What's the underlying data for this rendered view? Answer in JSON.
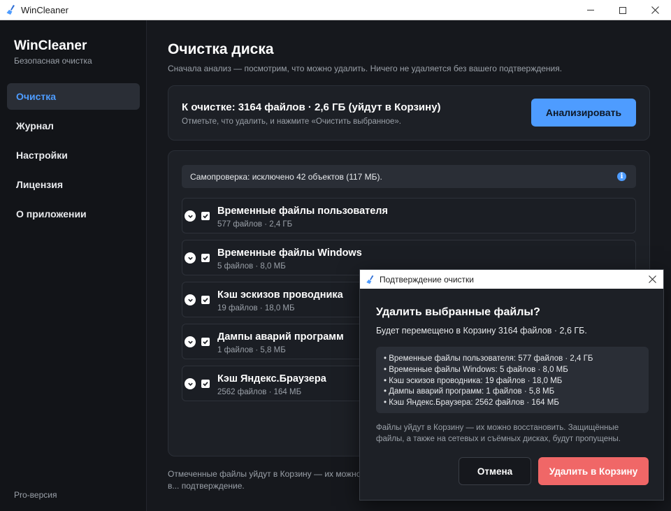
{
  "window": {
    "title": "WinCleaner",
    "icon": "broom-icon"
  },
  "sidebar": {
    "brand_name": "WinCleaner",
    "brand_sub": "Безопасная очистка",
    "items": [
      {
        "label": "Очистка",
        "active": true
      },
      {
        "label": "Журнал",
        "active": false
      },
      {
        "label": "Настройки",
        "active": false
      },
      {
        "label": "Лицензия",
        "active": false
      },
      {
        "label": "О приложении",
        "active": false
      }
    ],
    "pro_label": "Pro-версия"
  },
  "main": {
    "title": "Очистка диска",
    "subtitle": "Сначала анализ — посмотрим, что можно удалить. Ничего не удаляется без вашего подтверждения.",
    "summary": {
      "title": "К очистке: 3164 файлов · 2,6 ГБ (уйдут в Корзину)",
      "hint": "Отметьте, что удалить, и нажмите «Очистить выбранное».",
      "analyze_label": "Анализировать"
    },
    "selfcheck": "Самопроверка: исключено 42 объектов (117 МБ).",
    "categories": [
      {
        "name": "Временные файлы пользователя",
        "meta": "577 файлов · 2,4 ГБ",
        "checked": true
      },
      {
        "name": "Временные файлы Windows",
        "meta": "5 файлов · 8,0 МБ",
        "checked": true
      },
      {
        "name": "Кэш эскизов проводника",
        "meta": "19 файлов · 18,0 МБ",
        "checked": true
      },
      {
        "name": "Дампы аварий программ",
        "meta": "1 файлов · 5,8 МБ",
        "checked": true
      },
      {
        "name": "Кэш Яндекс.Браузера",
        "meta": "2562 файлов · 164 МБ",
        "checked": true
      }
    ],
    "footnote": "Отмеченные файлы уйдут в Корзину — их можно в... подтверждение."
  },
  "dialog": {
    "title": "Подтверждение очистки",
    "heading": "Удалить выбранные файлы?",
    "description": "Будет перемещено в Корзину 3164 файлов · 2,6 ГБ.",
    "items": [
      "• Временные файлы пользователя: 577 файлов · 2,4 ГБ",
      "• Временные файлы Windows: 5 файлов · 8,0 МБ",
      "• Кэш эскизов проводника: 19 файлов · 18,0 МБ",
      "• Дампы аварий программ: 1 файлов · 5,8 МБ",
      "• Кэш Яндекс.Браузера: 2562 файлов · 164 МБ"
    ],
    "note": "Файлы уйдут в Корзину — их можно восстановить. Защищённые файлы, а также на сетевых и съёмных дисках, будут пропущены.",
    "cancel_label": "Отмена",
    "delete_label": "Удалить в Корзину"
  },
  "colors": {
    "accent": "#4e9cff",
    "danger": "#f06767",
    "background": "#16181d",
    "surface": "#1d2026"
  }
}
